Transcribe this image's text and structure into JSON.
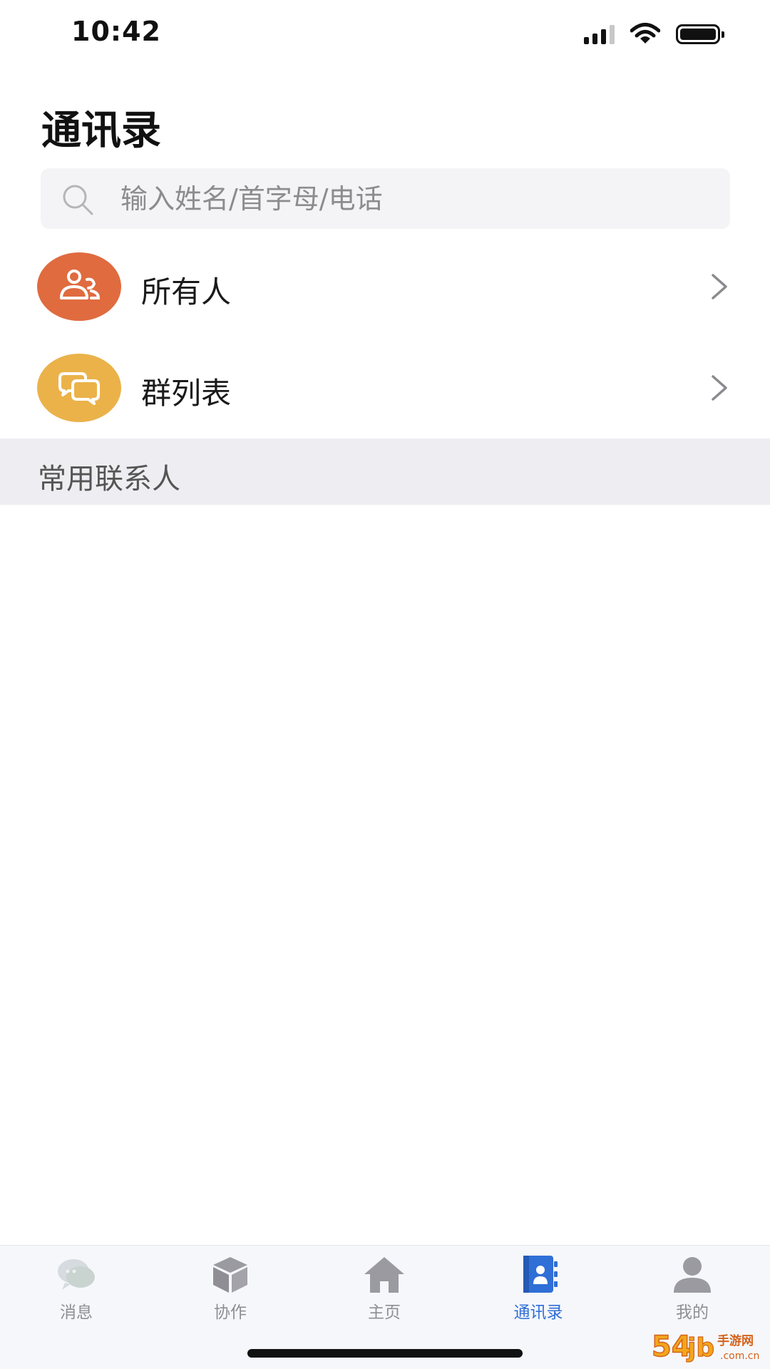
{
  "status_bar": {
    "time": "10:42",
    "icons": [
      "signal-icon",
      "wifi-icon",
      "battery-icon"
    ]
  },
  "header": {
    "title": "通讯录"
  },
  "search": {
    "placeholder": "输入姓名/首字母/电话",
    "value": ""
  },
  "menu": {
    "items": [
      {
        "label": "所有人",
        "icon": "people-icon",
        "color": "#e06b3f"
      },
      {
        "label": "群列表",
        "icon": "chat-bubbles-icon",
        "color": "#ebb24a"
      }
    ]
  },
  "section": {
    "label": "常用联系人"
  },
  "tab_bar": {
    "active": "通讯录",
    "active_color": "#2f6fd6",
    "inactive_color": "#8e8e93",
    "items": [
      {
        "label": "消息",
        "icon": "message-icon"
      },
      {
        "label": "协作",
        "icon": "cube-icon"
      },
      {
        "label": "主页",
        "icon": "home-icon"
      },
      {
        "label": "通讯录",
        "icon": "contacts-book-icon"
      },
      {
        "label": "我的",
        "icon": "person-icon"
      }
    ]
  },
  "watermark": {
    "text": "54.jb手游网 .com.cn"
  }
}
